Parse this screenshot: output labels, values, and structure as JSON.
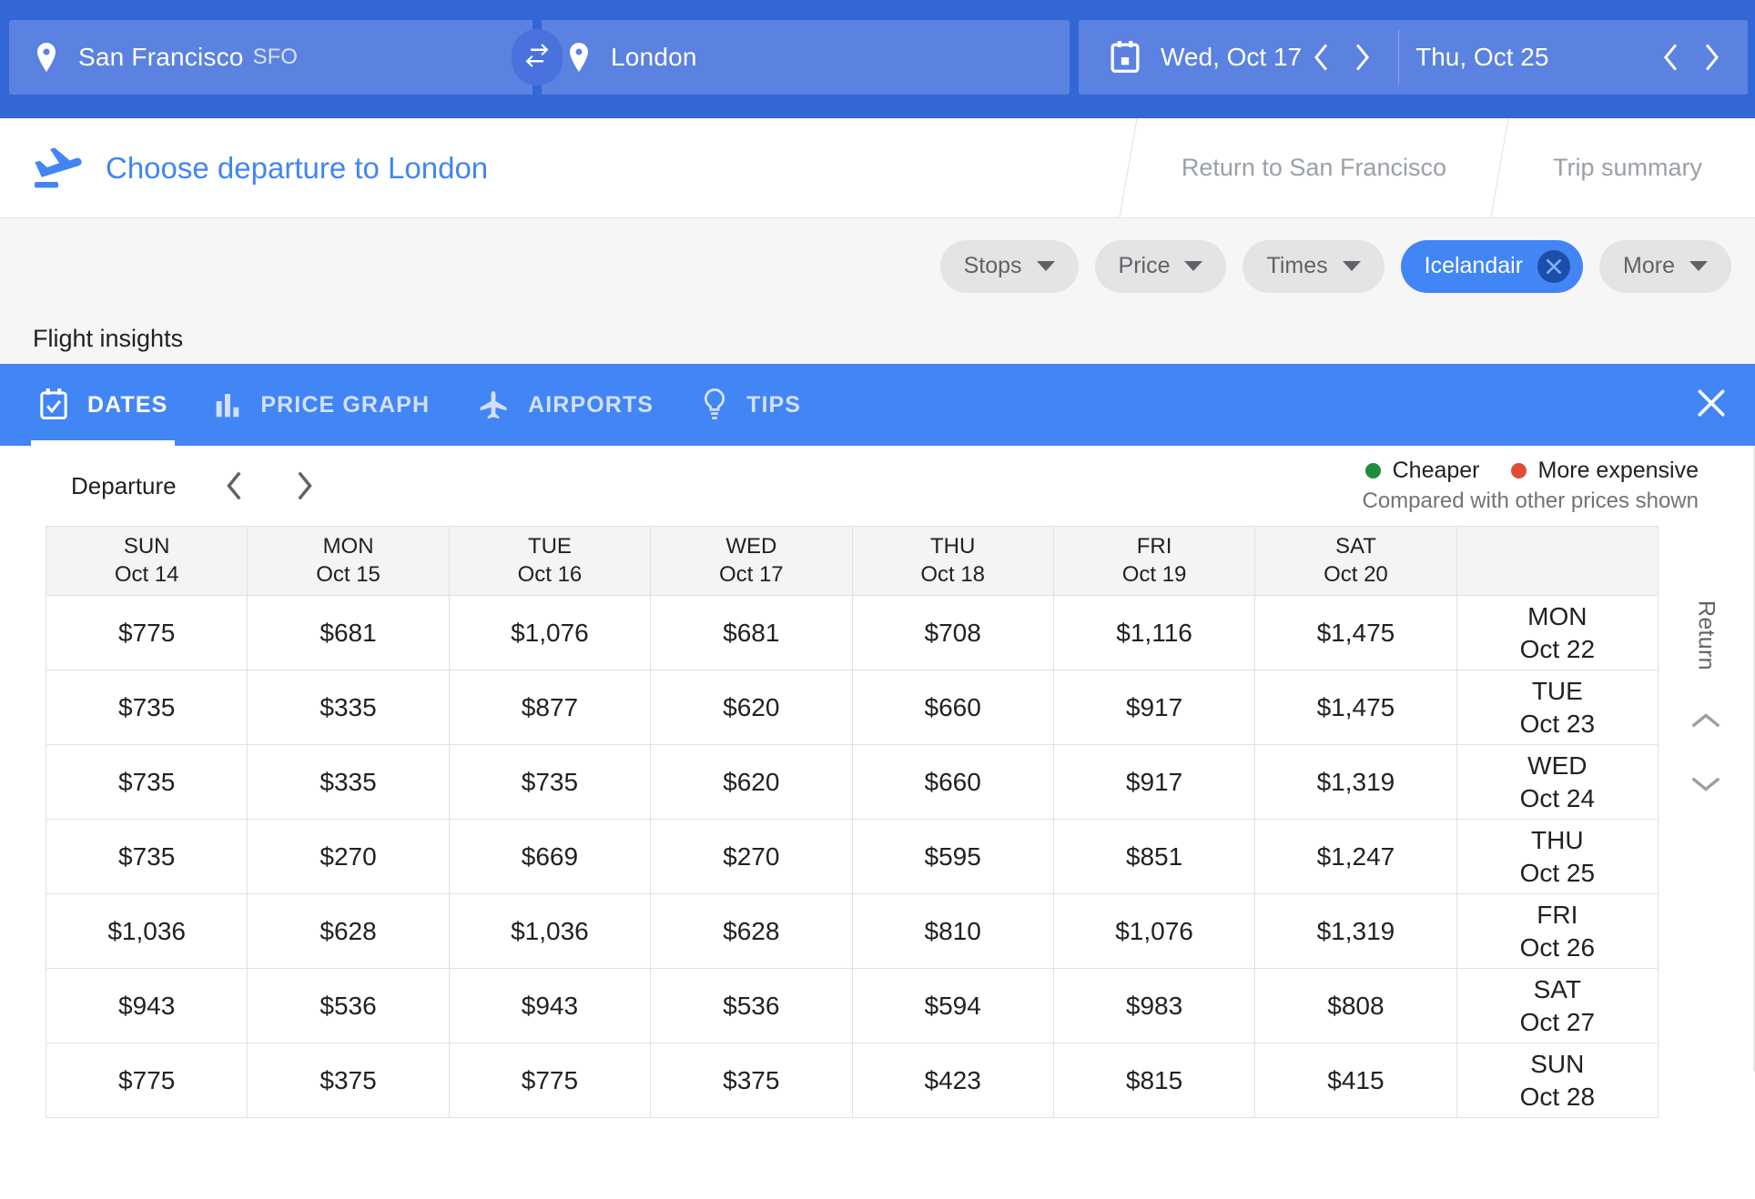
{
  "search": {
    "origin_city": "San Francisco",
    "origin_code": "SFO",
    "destination_city": "London",
    "depart_date": "Wed, Oct 17",
    "return_date": "Thu, Oct 25",
    "swap_icon": "swap-horizontal-icon",
    "calendar_icon": "calendar-icon"
  },
  "breadcrumb": {
    "step1": "Choose departure to London",
    "step2": "Return to San Francisco",
    "step3": "Trip summary"
  },
  "filters": {
    "stops": "Stops",
    "price": "Price",
    "times": "Times",
    "airline": "Icelandair",
    "more": "More"
  },
  "insights": {
    "title": "Flight insights",
    "tabs": [
      {
        "label": "DATES",
        "icon": "calendar-check-icon",
        "active": true
      },
      {
        "label": "PRICE GRAPH",
        "icon": "bar-chart-icon",
        "active": false
      },
      {
        "label": "AIRPORTS",
        "icon": "airplane-icon",
        "active": false
      },
      {
        "label": "TIPS",
        "icon": "lightbulb-icon",
        "active": false
      }
    ],
    "close_icon": "close-icon"
  },
  "grid": {
    "departure_label": "Departure",
    "return_label": "Return",
    "legend": {
      "cheaper": "Cheaper",
      "more_expensive": "More expensive",
      "note": "Compared with other prices shown",
      "cheaper_color": "#1e8e3e",
      "expensive_color": "#e04b3a"
    },
    "columns": [
      {
        "dow": "SUN",
        "date": "Oct 14",
        "selected": false
      },
      {
        "dow": "MON",
        "date": "Oct 15",
        "selected": false
      },
      {
        "dow": "TUE",
        "date": "Oct 16",
        "selected": false
      },
      {
        "dow": "WED",
        "date": "Oct 17",
        "selected": true
      },
      {
        "dow": "THU",
        "date": "Oct 18",
        "selected": false
      },
      {
        "dow": "FRI",
        "date": "Oct 19",
        "selected": false
      },
      {
        "dow": "SAT",
        "date": "Oct 20",
        "selected": false
      }
    ],
    "rows": [
      {
        "return_dow": "MON",
        "return_date": "Oct 22",
        "selected": false,
        "cells": [
          {
            "price": "$775",
            "state": "normal"
          },
          {
            "price": "$681",
            "state": "normal"
          },
          {
            "price": "$1,076",
            "state": "normal"
          },
          {
            "price": "$681",
            "state": "col-sel"
          },
          {
            "price": "$708",
            "state": "normal"
          },
          {
            "price": "$1,116",
            "state": "normal"
          },
          {
            "price": "$1,475",
            "state": "expensive"
          }
        ]
      },
      {
        "return_dow": "TUE",
        "return_date": "Oct 23",
        "selected": false,
        "cells": [
          {
            "price": "$735",
            "state": "normal"
          },
          {
            "price": "$335",
            "state": "cheap"
          },
          {
            "price": "$877",
            "state": "normal"
          },
          {
            "price": "$620",
            "state": "col-sel"
          },
          {
            "price": "$660",
            "state": "normal"
          },
          {
            "price": "$917",
            "state": "normal"
          },
          {
            "price": "$1,475",
            "state": "expensive"
          }
        ]
      },
      {
        "return_dow": "WED",
        "return_date": "Oct 24",
        "selected": false,
        "cells": [
          {
            "price": "$735",
            "state": "normal"
          },
          {
            "price": "$335",
            "state": "cheap"
          },
          {
            "price": "$735",
            "state": "normal"
          },
          {
            "price": "$620",
            "state": "col-sel"
          },
          {
            "price": "$660",
            "state": "normal"
          },
          {
            "price": "$917",
            "state": "normal"
          },
          {
            "price": "$1,319",
            "state": "expensive"
          }
        ]
      },
      {
        "return_dow": "THU",
        "return_date": "Oct 25",
        "selected": true,
        "cells": [
          {
            "price": "$735",
            "state": "row-sel"
          },
          {
            "price": "$270",
            "state": "best"
          },
          {
            "price": "$669",
            "state": "row-sel"
          },
          {
            "price": "$270",
            "state": "selected"
          },
          {
            "price": "$595",
            "state": "row-sel"
          },
          {
            "price": "$851",
            "state": "row-sel"
          },
          {
            "price": "$1,247",
            "state": "expensive-row-sel"
          }
        ]
      },
      {
        "return_dow": "FRI",
        "return_date": "Oct 26",
        "selected": false,
        "cells": [
          {
            "price": "$1,036",
            "state": "normal"
          },
          {
            "price": "$628",
            "state": "normal"
          },
          {
            "price": "$1,036",
            "state": "normal"
          },
          {
            "price": "$628",
            "state": "normal"
          },
          {
            "price": "$810",
            "state": "normal"
          },
          {
            "price": "$1,076",
            "state": "normal"
          },
          {
            "price": "$1,319",
            "state": "expensive"
          }
        ]
      },
      {
        "return_dow": "SAT",
        "return_date": "Oct 27",
        "selected": false,
        "cells": [
          {
            "price": "$943",
            "state": "normal"
          },
          {
            "price": "$536",
            "state": "normal"
          },
          {
            "price": "$943",
            "state": "normal"
          },
          {
            "price": "$536",
            "state": "normal"
          },
          {
            "price": "$594",
            "state": "normal"
          },
          {
            "price": "$983",
            "state": "normal"
          },
          {
            "price": "$808",
            "state": "normal"
          }
        ]
      },
      {
        "return_dow": "SUN",
        "return_date": "Oct 28",
        "selected": false,
        "cells": [
          {
            "price": "$775",
            "state": "normal"
          },
          {
            "price": "$375",
            "state": "cheap"
          },
          {
            "price": "$775",
            "state": "normal"
          },
          {
            "price": "$375",
            "state": "cheap"
          },
          {
            "price": "$423",
            "state": "cheap"
          },
          {
            "price": "$815",
            "state": "normal"
          },
          {
            "price": "$415",
            "state": "cheap"
          }
        ]
      }
    ]
  }
}
